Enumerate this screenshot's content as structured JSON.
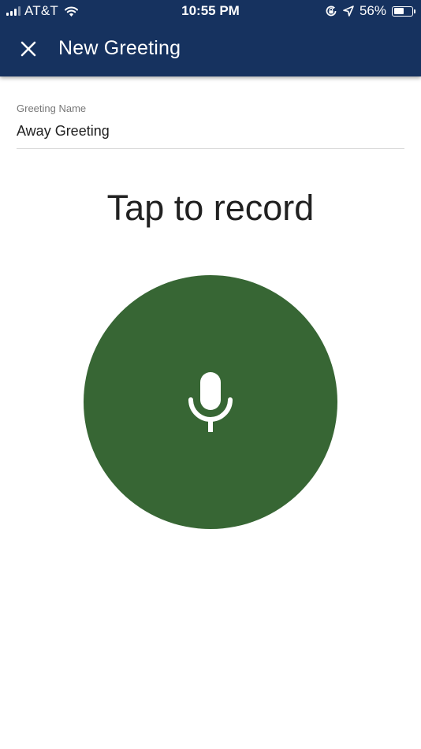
{
  "status_bar": {
    "carrier": "AT&T",
    "time": "10:55 PM",
    "battery_percent": "56%",
    "battery_level": 0.56,
    "icons": [
      "cellular-signal-icon",
      "wifi-icon",
      "rotation-lock-icon",
      "location-arrow-icon",
      "battery-icon"
    ]
  },
  "app_bar": {
    "title": "New Greeting",
    "close_icon": "close-icon",
    "background_color": "#16325f"
  },
  "form": {
    "greeting_name_label": "Greeting Name",
    "greeting_name_value": "Away Greeting"
  },
  "recorder": {
    "prompt": "Tap to record",
    "button_icon": "microphone-icon",
    "button_color": "#376634"
  }
}
